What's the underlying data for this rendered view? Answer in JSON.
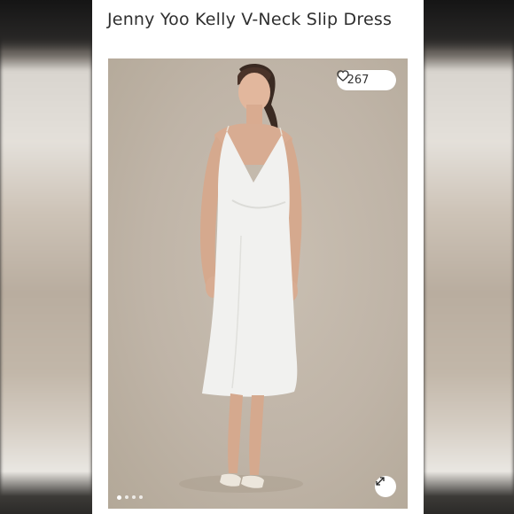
{
  "product": {
    "title": "Jenny Yoo Kelly V-Neck Slip Dress"
  },
  "gallery": {
    "like_count": "267",
    "like_icon": "heart-icon",
    "expand_icon": "expand-icon",
    "image_count": 4,
    "active_image": 1
  },
  "colors": {
    "card_background": "#ffffff",
    "photo_background": "#c3b8ab",
    "dress": "#f1f1ef",
    "title_text": "#2f2f2f"
  }
}
